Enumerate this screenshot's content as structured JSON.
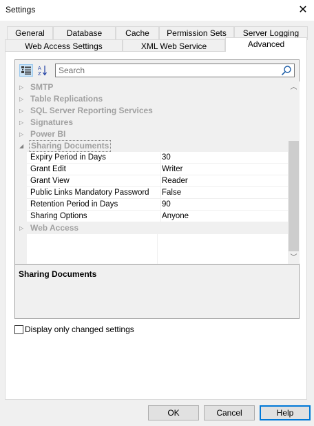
{
  "window": {
    "title": "Settings",
    "close_glyph": "✕"
  },
  "tabs_back": [
    "General",
    "Database",
    "Cache",
    "Permission Sets",
    "Server Logging"
  ],
  "tabs_front": [
    "Web Access Settings",
    "XML Web Service",
    "Advanced"
  ],
  "active_tab": "Advanced",
  "toolbar": {
    "categorized_icon": "categorized-icon",
    "alphabetical_icon": "alphabetical-sort-icon",
    "alpha_glyph": "A↓Z",
    "search_placeholder": "Search"
  },
  "categories_before": [
    {
      "name": "SMTP",
      "expanded": false
    },
    {
      "name": "Table Replications",
      "expanded": false
    },
    {
      "name": "SQL Server Reporting Services",
      "expanded": false
    },
    {
      "name": "Signatures",
      "expanded": false
    },
    {
      "name": "Power BI",
      "expanded": false
    }
  ],
  "open_category": {
    "name": "Sharing Documents",
    "expanded": true,
    "properties": [
      {
        "key": "Expiry Period in Days",
        "value": "30"
      },
      {
        "key": "Grant Edit",
        "value": "Writer"
      },
      {
        "key": "Grant View",
        "value": "Reader"
      },
      {
        "key": "Public Links Mandatory Password",
        "value": "False"
      },
      {
        "key": "Retention Period in Days",
        "value": "90"
      },
      {
        "key": "Sharing Options",
        "value": "Anyone"
      }
    ]
  },
  "categories_after": [
    {
      "name": "Web Access",
      "expanded": false
    }
  ],
  "arrows": {
    "collapsed": "▷",
    "expanded": "◢",
    "up": "︿",
    "down": "﹀"
  },
  "description": {
    "title": "Sharing Documents"
  },
  "checkbox": {
    "label": "Display only changed settings",
    "checked": false
  },
  "buttons": {
    "ok": "OK",
    "cancel": "Cancel",
    "help": "Help"
  }
}
